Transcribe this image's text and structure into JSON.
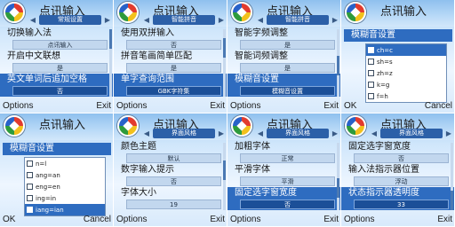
{
  "app_title": "点讯输入",
  "colors": {
    "selected_bg": "#2e6cc0",
    "tab_bg": "#2c60a8"
  },
  "screens": [
    {
      "tab": "常规设置",
      "type": "settings",
      "settings": [
        {
          "label": "切换输入法",
          "value": "点讯输入",
          "selected": false
        },
        {
          "label": "开启中文联想",
          "value": "是",
          "selected": false
        },
        {
          "label": "英文单词后追加空格",
          "value": "否",
          "selected": true
        }
      ],
      "softkeys": {
        "left": "Options",
        "right": "Exit"
      }
    },
    {
      "tab": "智能拼音",
      "type": "settings",
      "settings": [
        {
          "label": "使用双拼输入",
          "value": "否",
          "selected": false
        },
        {
          "label": "拼音笔画简单匹配",
          "value": "是",
          "selected": false
        },
        {
          "label": "单字查询范围",
          "value": "GBK字符集",
          "selected": true
        }
      ],
      "softkeys": {
        "left": "Options",
        "right": "Exit"
      }
    },
    {
      "tab": "智能拼音",
      "type": "settings",
      "settings": [
        {
          "label": "智能字频调整",
          "value": "是",
          "selected": false
        },
        {
          "label": "智能词频调整",
          "value": "是",
          "selected": false
        },
        {
          "label": "模糊音设置",
          "value": "模糊音设置",
          "selected": true
        }
      ],
      "softkeys": {
        "left": "Options",
        "right": "Exit"
      }
    },
    {
      "tab": "",
      "type": "fuzzy",
      "fuzzy_title": "模糊音设置",
      "items": [
        {
          "label": "ch=c",
          "checked": true,
          "focused": true
        },
        {
          "label": "sh=s",
          "checked": false,
          "focused": false
        },
        {
          "label": "zh=z",
          "checked": false,
          "focused": false
        },
        {
          "label": "k=g",
          "checked": false,
          "focused": false
        },
        {
          "label": "f=h",
          "checked": false,
          "focused": false
        }
      ],
      "softkeys": {
        "left": "OK",
        "right": "Cancel"
      }
    },
    {
      "tab": "",
      "type": "fuzzy",
      "fuzzy_title": "模糊音设置",
      "items": [
        {
          "label": "n=l",
          "checked": false,
          "focused": false
        },
        {
          "label": "ang=an",
          "checked": false,
          "focused": false
        },
        {
          "label": "eng=en",
          "checked": false,
          "focused": false
        },
        {
          "label": "ing=in",
          "checked": false,
          "focused": false
        },
        {
          "label": "iang=ian",
          "checked": true,
          "focused": true
        }
      ],
      "softkeys": {
        "left": "OK",
        "right": "Cancel"
      }
    },
    {
      "tab": "界面风格",
      "type": "settings",
      "settings": [
        {
          "label": "颜色主题",
          "value": "默认",
          "selected": false
        },
        {
          "label": "数字输入提示",
          "value": "否",
          "selected": false
        },
        {
          "label": "字体大小",
          "value": "19",
          "selected": false
        }
      ],
      "softkeys": {
        "left": "Options",
        "right": "Exit"
      }
    },
    {
      "tab": "界面风格",
      "type": "settings",
      "settings": [
        {
          "label": "加粗字体",
          "value": "正常",
          "selected": false
        },
        {
          "label": "平滑字体",
          "value": "平滑",
          "selected": false
        },
        {
          "label": "固定选字窗宽度",
          "value": "否",
          "selected": true
        }
      ],
      "softkeys": {
        "left": "Options",
        "right": "Exit"
      }
    },
    {
      "tab": "界面风格",
      "type": "settings",
      "settings": [
        {
          "label": "固定选字窗宽度",
          "value": "否",
          "selected": false
        },
        {
          "label": "输入法指示器位置",
          "value": "浮动",
          "selected": false
        },
        {
          "label": "状态指示器透明度",
          "value": "33",
          "selected": true
        }
      ],
      "softkeys": {
        "left": "Options",
        "right": "Exit"
      }
    }
  ]
}
